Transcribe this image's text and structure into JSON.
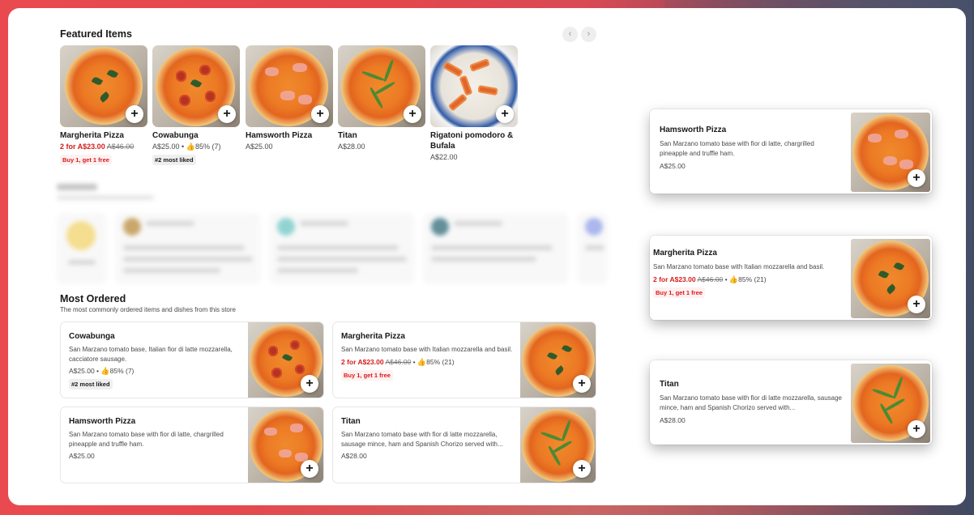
{
  "featured": {
    "title": "Featured Items",
    "prev_icon": "chevron-left-icon",
    "next_icon": "chevron-right-icon",
    "items": [
      {
        "name": "Margherita Pizza",
        "promo_price": "2 for A$23.00",
        "orig_price": "A$46.00",
        "badge": "Buy 1, get 1 free"
      },
      {
        "name": "Cowabunga",
        "price": "A$25.00",
        "sep": "•",
        "rating": "85% (7)",
        "badge": "#2 most liked"
      },
      {
        "name": "Hamsworth Pizza",
        "price": "A$25.00"
      },
      {
        "name": "Titan",
        "price": "A$28.00"
      },
      {
        "name": "Rigatoni pomodoro & Bufala",
        "price": "A$22.00"
      }
    ]
  },
  "most_ordered": {
    "title": "Most Ordered",
    "subtitle": "The most commonly ordered items and dishes from this store",
    "items": [
      {
        "name": "Cowabunga",
        "desc": "San Marzano tomato base, Italian fior di latte mozzarella, cacciatore sausage.",
        "price": "A$25.00",
        "sep": "•",
        "rating": "85% (7)",
        "badge": "#2 most liked"
      },
      {
        "name": "Margherita Pizza",
        "desc": "San Marzano tomato base with Italian mozzarella and basil.",
        "promo_price": "2 for A$23.00",
        "orig_price": "A$46.00",
        "sep": "•",
        "rating": "85% (21)",
        "badge": "Buy 1, get 1 free"
      },
      {
        "name": "Hamsworth Pizza",
        "desc": "San Marzano tomato base with fior di latte, chargrilled pineapple and truffle ham.",
        "price": "A$25.00"
      },
      {
        "name": "Titan",
        "desc": "San Marzano tomato base with fior di latte mozzarella, sausage mince, ham and Spanish Chorizo served with...",
        "price": "A$28.00"
      }
    ]
  },
  "highlight_cards": [
    {
      "name": "Hamsworth Pizza",
      "desc": "San Marzano tomato base with fior di latte, chargrilled pineapple and truffle ham.",
      "price": "A$25.00"
    },
    {
      "name": "Margherita Pizza",
      "desc": "San Marzano tomato base with Italian mozzarella and basil.",
      "promo_price": "2 for A$23.00",
      "orig_price": "A$46.00",
      "sep": "•",
      "rating": "85% (21)",
      "badge": "Buy 1, get 1 free"
    },
    {
      "name": "Titan",
      "desc": "San Marzano tomato base with fior di latte mozzarella, sausage mince, ham and Spanish Chorizo served with...",
      "price": "A$28.00"
    }
  ],
  "add_label": "+",
  "colors": {
    "promo": "#d91a1a",
    "background": "#e84a4f",
    "panel": "#ffffff"
  }
}
